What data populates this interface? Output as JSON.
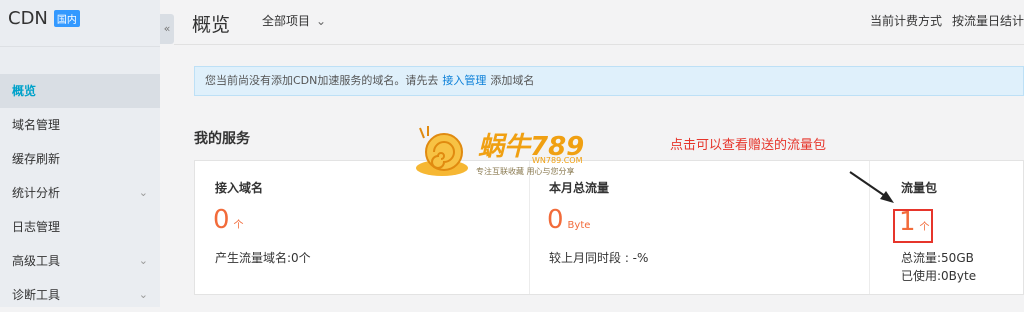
{
  "sidebar": {
    "brand": "CDN",
    "badge": "国内",
    "collapse_icon": "double-chevron-left",
    "items": [
      {
        "label": "概览",
        "active": true,
        "chevron": false
      },
      {
        "label": "域名管理",
        "active": false,
        "chevron": false
      },
      {
        "label": "缓存刷新",
        "active": false,
        "chevron": false
      },
      {
        "label": "统计分析",
        "active": false,
        "chevron": true
      },
      {
        "label": "日志管理",
        "active": false,
        "chevron": false
      },
      {
        "label": "高级工具",
        "active": false,
        "chevron": true
      },
      {
        "label": "诊断工具",
        "active": false,
        "chevron": true
      }
    ]
  },
  "header": {
    "title": "概览",
    "project_select": "全部项目",
    "billing_label": "当前计费方式",
    "billing_value": "按流量日结计"
  },
  "notice": {
    "text_before": "您当前尚没有添加CDN加速服务的域名。请先去",
    "link": "接入管理",
    "text_after": "添加域名"
  },
  "services": {
    "title": "我的服务",
    "annotation": "点击可以查看赠送的流量包",
    "domains": {
      "title": "接入域名",
      "value": "0",
      "unit": "个",
      "sub": "产生流量域名:0个"
    },
    "traffic": {
      "title": "本月总流量",
      "value": "0",
      "unit": "Byte",
      "sub": "较上月同时段 :  -%"
    },
    "package": {
      "title": "流量包",
      "value": "1",
      "unit": "个",
      "total": "总流量:50GB",
      "used": "已使用:0Byte"
    }
  },
  "watermark": {
    "title": "蜗牛789",
    "site": "WN789.COM",
    "tagline": "专注互联收藏  用心与您分享"
  },
  "colors": {
    "accent": "#00a2ca",
    "highlight": "#e6352b",
    "number": "#f26b3a",
    "link": "#0a7fd8"
  }
}
